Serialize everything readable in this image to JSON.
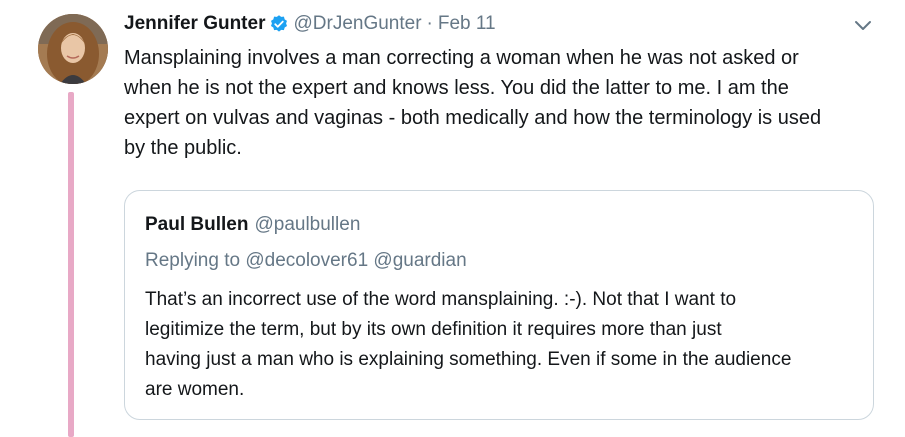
{
  "tweet": {
    "author_name": "Jennifer Gunter",
    "author_handle": "@DrJenGunter",
    "separator": "·",
    "date": "Feb 11",
    "text": "Mansplaining involves a man correcting a woman when he was not asked or\nwhen he is not the expert and knows less. You did the latter to me. I am the\nexpert on vulvas and vaginas - both medically and how the terminology is used\nby the public.",
    "thread_line_color": "#e8a9c6",
    "verified_color": "#1da1f2"
  },
  "quoted_tweet": {
    "author_name": "Paul Bullen",
    "author_handle": "@paulbullen",
    "replying_to": "Replying to @decolover61 @guardian",
    "text": "That’s an incorrect use of the word mansplaining. :-). Not that I want to\nlegitimize the term, but by its own definition it requires more than just\nhaving just a man who is explaining something. Even if some in the audience\nare women."
  },
  "icons": {
    "verified": "verified-badge-icon",
    "menu": "chevron-down-icon"
  }
}
